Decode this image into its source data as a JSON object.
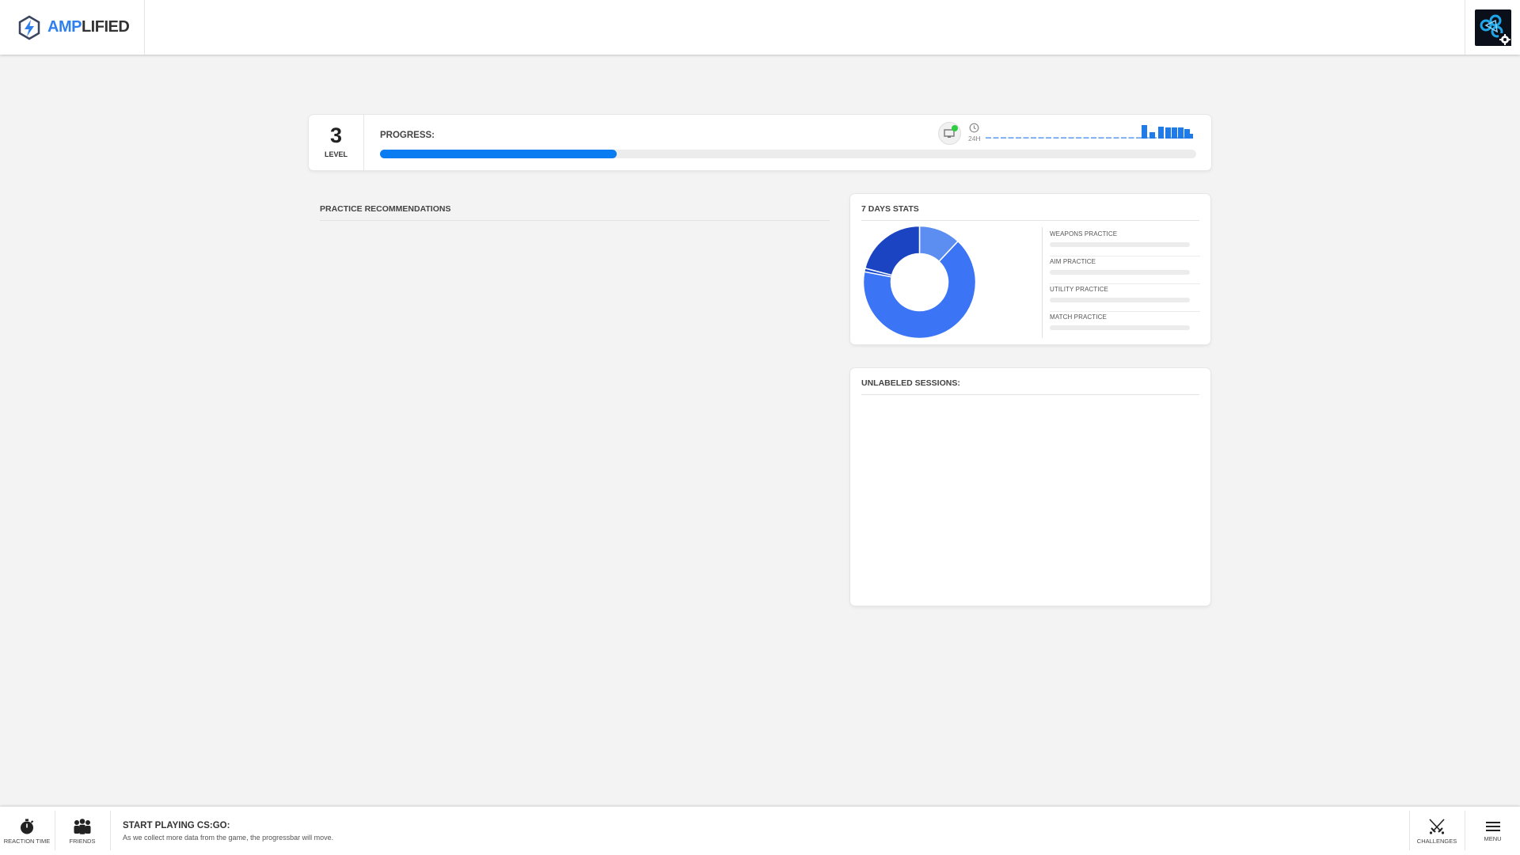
{
  "header": {
    "logo_part1": "AMP",
    "logo_part2": "LIFIED",
    "colors": {
      "accent": "#2f80ed"
    }
  },
  "level_card": {
    "level_number": "3",
    "level_label": "LEVEL",
    "progress_label": "PROGRESS:",
    "progress_fraction": 0.29,
    "time_range_label": "24H",
    "activity_bars": [
      1,
      1,
      1,
      1,
      1,
      1,
      1,
      1,
      1,
      1,
      1,
      1,
      1,
      1,
      1,
      1,
      1,
      1,
      1,
      1,
      1,
      1,
      1,
      1,
      1,
      1,
      1,
      1,
      1,
      1,
      1,
      1,
      1,
      1,
      1,
      1,
      1,
      1,
      1,
      1,
      1,
      1,
      1,
      1,
      1,
      1,
      1,
      1,
      1,
      1,
      1,
      1,
      1,
      1,
      1,
      1,
      1,
      1,
      1,
      1,
      1,
      1,
      1,
      1,
      1,
      1,
      1,
      1,
      1,
      1,
      1,
      1,
      1,
      1,
      1,
      1,
      1,
      1,
      1,
      1,
      1,
      1,
      1,
      1,
      1,
      1,
      1,
      1,
      1,
      1,
      1,
      1,
      1,
      1,
      1,
      1,
      1,
      1,
      1,
      1,
      1,
      1,
      1,
      1,
      1,
      1,
      1,
      1,
      1,
      1,
      1,
      1,
      1,
      1,
      1,
      1,
      1,
      1,
      1,
      1,
      1,
      1,
      1,
      1,
      1,
      1,
      1,
      1,
      1,
      1,
      1,
      1,
      1,
      1,
      1,
      1,
      1,
      1,
      1,
      1,
      1,
      1,
      1,
      1,
      1,
      1,
      1,
      1,
      1,
      1,
      1,
      1,
      1,
      1,
      1,
      1,
      1,
      1,
      1,
      1,
      1,
      1,
      1,
      1,
      1,
      1,
      1,
      1,
      1,
      1,
      1,
      1,
      1,
      1,
      1,
      1,
      1,
      1,
      1,
      1,
      1,
      1,
      1,
      1,
      1,
      1,
      1,
      1,
      1,
      1,
      1,
      1,
      1,
      1,
      1,
      1,
      1,
      1,
      1,
      1,
      1,
      1,
      1,
      1,
      1,
      1,
      1,
      1,
      1,
      1,
      1,
      1,
      1,
      1,
      1,
      1,
      1,
      1,
      1,
      1,
      1,
      1,
      1,
      1,
      1,
      1,
      1,
      1,
      1,
      1,
      1,
      1,
      1,
      1,
      1,
      1,
      1,
      1,
      1,
      1,
      1,
      1,
      1,
      1,
      1,
      1,
      1,
      1,
      1,
      1,
      1,
      1,
      1,
      1,
      1,
      1,
      1,
      1,
      1,
      1,
      1,
      1,
      1,
      1,
      1,
      1,
      1,
      1,
      1,
      1
    ]
  },
  "practice": {
    "title": "PRACTICE RECOMMENDATIONS"
  },
  "stats": {
    "title": "7 DAYS STATS",
    "items": [
      {
        "label": "WEAPONS PRACTICE"
      },
      {
        "label": "AIM PRACTICE"
      },
      {
        "label": "UTILITY PRACTICE"
      },
      {
        "label": "MATCH PRACTICE"
      }
    ],
    "donut": {
      "segments": [
        {
          "value": 12,
          "color": "#5c8ef2"
        },
        {
          "value": 66,
          "color": "#3b74f5"
        },
        {
          "value": 1,
          "color": "#1d4ed0"
        },
        {
          "value": 21,
          "color": "#1a44c2"
        }
      ]
    }
  },
  "sessions": {
    "title": "UNLABELED SESSIONS:"
  },
  "bottombar": {
    "reaction_label": "REACTION TIME",
    "friends_label": "FRIENDS",
    "play_title": "START PLAYING CS:GO:",
    "play_subtitle": "As we collect more data from the game, the progressbar will move.",
    "challenges_label": "CHALLENGES",
    "menu_label": "MENU"
  }
}
